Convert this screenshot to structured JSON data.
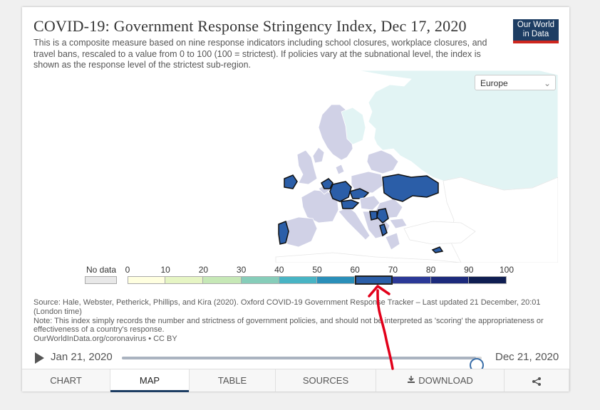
{
  "header": {
    "title": "COVID-19: Government Response Stringency Index, Dec 17, 2020",
    "subtitle": "This is a composite measure based on nine response indicators including school closures, workplace closures, and travel bans, rescaled to a value from 0 to 100 (100 = strictest). If policies vary at the subnational level, the index is shown as the response level of the strictest sub-region.",
    "logo_line1": "Our World",
    "logo_line2": "in Data"
  },
  "map": {
    "region_selector": "Europe",
    "highlighted_countries": [
      "Portugal",
      "Ireland",
      "Netherlands",
      "Germany",
      "Czechia",
      "Austria",
      "Serbia",
      "Bosnia and Herzegovina",
      "Albania",
      "Ukraine",
      "Cyprus"
    ],
    "colors": {
      "ocean": "#ffffff",
      "nodata": "#e8e8e8",
      "light_lilac": "#d0d1e6",
      "light_cyan": "#e2f4f4",
      "mid_teal": "#7fc8c3",
      "highlight_fill": "#2b5ea8",
      "highlight_border": "#111111"
    }
  },
  "legend": {
    "nodata_label": "No data",
    "ticks": [
      "0",
      "10",
      "20",
      "30",
      "40",
      "50",
      "60",
      "70",
      "80",
      "90",
      "100"
    ],
    "bins": [
      {
        "color": "#ffffe0"
      },
      {
        "color": "#e6f5c4"
      },
      {
        "color": "#c6e8b6"
      },
      {
        "color": "#86cdb9"
      },
      {
        "color": "#48b4c4"
      },
      {
        "color": "#2a8fb9"
      },
      {
        "color": "#2b5ea8",
        "highlight": true
      },
      {
        "color": "#2b3997"
      },
      {
        "color": "#1c2a7c"
      },
      {
        "color": "#0f1e52"
      }
    ]
  },
  "sources": {
    "line1": "Source: Hale, Webster, Petherick, Phillips, and Kira (2020). Oxford COVID-19 Government Response Tracker – Last updated 21 December, 20:01 (London time)",
    "line2": "Note: This index simply records the number and strictness of government policies, and should not be interpreted as 'scoring' the appropriateness or effectiveness of a country's response.",
    "line3": "OurWorldInData.org/coronavirus • CC BY"
  },
  "timeline": {
    "start": "Jan 21, 2020",
    "end": "Dec 21, 2020",
    "position_fraction": 0.985
  },
  "tabs": [
    {
      "label": "Chart",
      "name": "tab-chart",
      "width": 124,
      "active": false
    },
    {
      "label": "Map",
      "name": "tab-map",
      "width": 111,
      "active": true
    },
    {
      "label": "Table",
      "name": "tab-table",
      "width": 121,
      "active": false
    },
    {
      "label": "Sources",
      "name": "tab-sources",
      "width": 141,
      "active": false
    },
    {
      "label": "Download",
      "name": "tab-download",
      "width": 180,
      "active": false,
      "icon": "download-icon"
    },
    {
      "label": "",
      "name": "tab-share",
      "width": 91,
      "active": false,
      "icon": "share-icon"
    }
  ],
  "annotation": {
    "arrow_color": "#e2001a"
  }
}
